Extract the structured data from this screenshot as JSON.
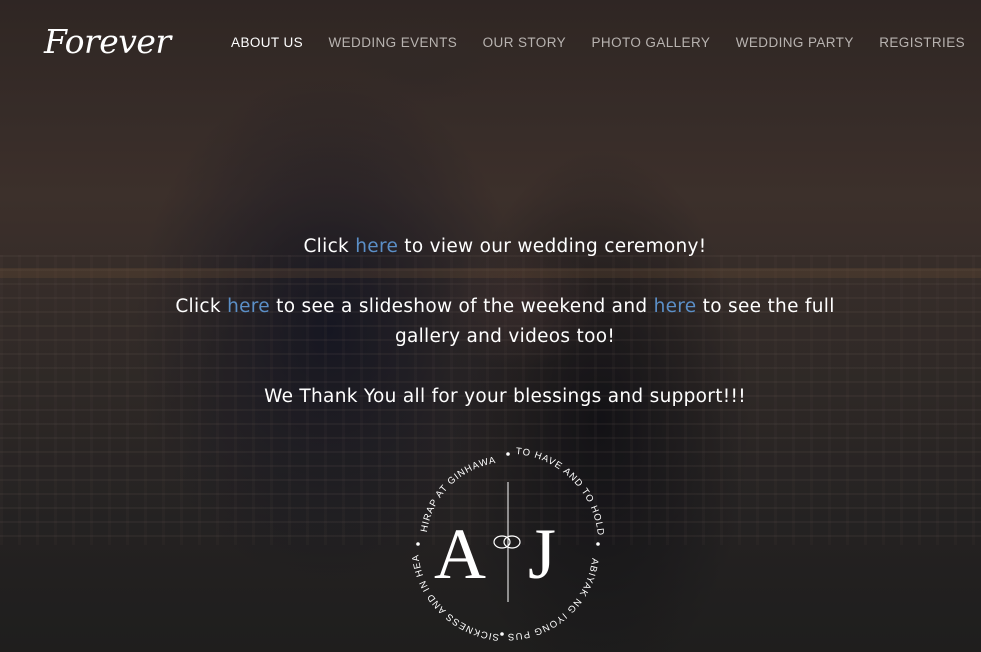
{
  "header": {
    "logo_text": "Forever",
    "nav": [
      {
        "label": "ABOUT US",
        "active": true
      },
      {
        "label": "WEDDING EVENTS",
        "active": false
      },
      {
        "label": "OUR STORY",
        "active": false
      },
      {
        "label": "PHOTO GALLERY",
        "active": false
      },
      {
        "label": "WEDDING PARTY",
        "active": false
      },
      {
        "label": "REGISTRIES",
        "active": false
      }
    ]
  },
  "main": {
    "line1": {
      "prefix": "Click ",
      "link": "here",
      "suffix": " to view our wedding ceremony!"
    },
    "line2": {
      "prefix": "Click ",
      "link1": "here",
      "middle": " to see a slideshow of the weekend and ",
      "link2": "here",
      "suffix": " to see the full gallery and videos too!"
    },
    "line3": "We Thank You all for your blessings and support!!!"
  },
  "monogram": {
    "initial_left": "A",
    "initial_right": "J",
    "ring_text_top": "HIRAP AT GINHAWA",
    "ring_text_right_top": "TO HAVE AND TO HOLD",
    "ring_text_right": "KABIYAK NG IYONG PUSO",
    "ring_text_left": "IN SICKNESS AND IN HEALTH"
  },
  "colors": {
    "link": "#5b8fc7",
    "nav_inactive": "#b8b3b0",
    "nav_active": "#ffffff",
    "text": "#ffffff"
  }
}
